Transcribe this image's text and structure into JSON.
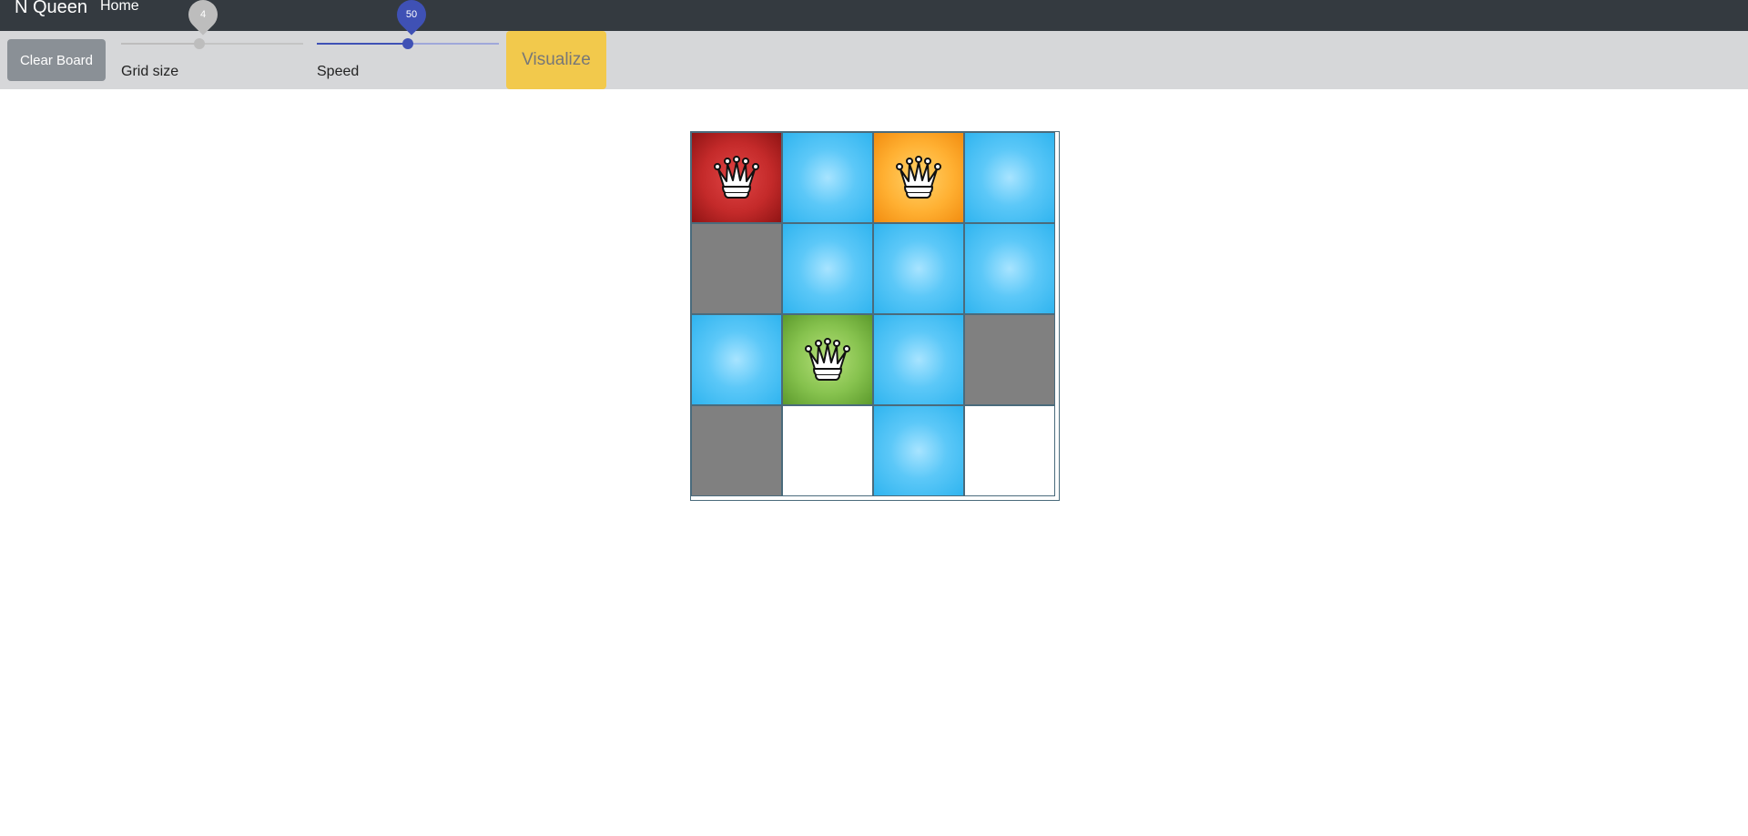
{
  "navbar": {
    "brand": "N Queen",
    "home_link": "Home"
  },
  "toolbar": {
    "clear_label": "Clear Board",
    "grid_size": {
      "label": "Grid size",
      "value": "4",
      "fraction": 0.43,
      "color": "#bdbdbd"
    },
    "speed": {
      "label": "Speed",
      "value": "50",
      "fraction": 0.5,
      "color": "#3f51b5"
    },
    "visualize_label": "Visualize"
  },
  "board": {
    "size": 4,
    "cells": [
      [
        "red",
        "blue",
        "orange",
        "blue"
      ],
      [
        "gray",
        "blue",
        "blue",
        "blue"
      ],
      [
        "blue",
        "green",
        "blue",
        "gray"
      ],
      [
        "gray",
        "white",
        "blue",
        "white"
      ]
    ],
    "queens": [
      [
        0,
        0
      ],
      [
        0,
        2
      ],
      [
        2,
        1
      ]
    ],
    "queen_icon": "queen-crown-icon"
  },
  "colors": {
    "navbar": "#343a40",
    "toolbar": "#d6d7d9",
    "visualize": "#f2c94c",
    "clear_button": "#8a9096"
  }
}
